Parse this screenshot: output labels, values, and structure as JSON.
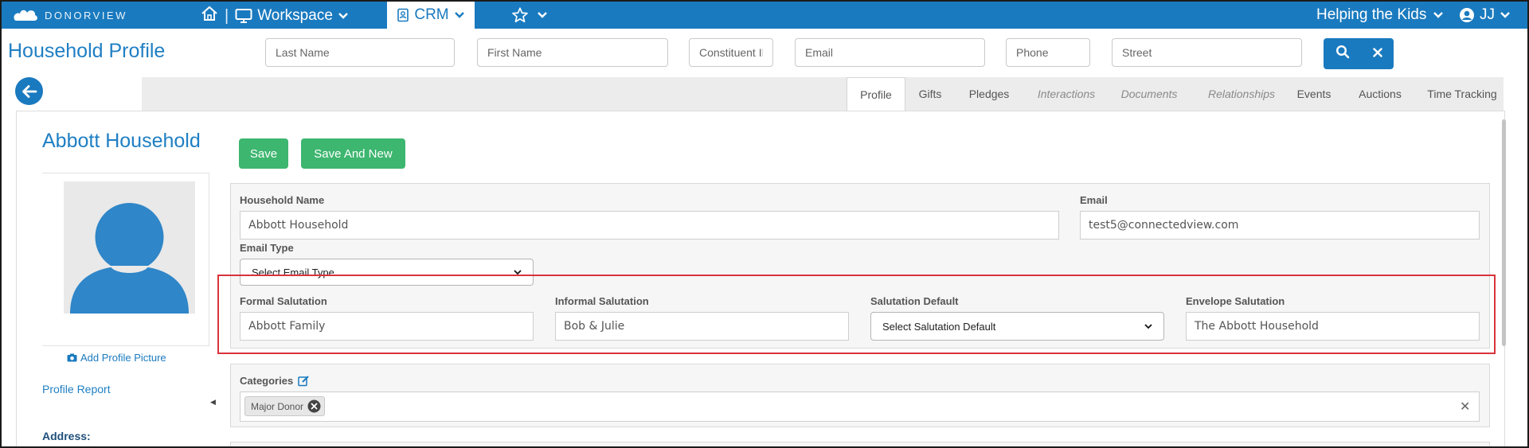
{
  "topbar": {
    "logo_text": "DONORVIEW",
    "workspace_label": "Workspace",
    "separator": "|",
    "crm_label": "CRM",
    "org_name": "Helping the Kids",
    "user_initials": "JJ"
  },
  "page_title": "Household Profile",
  "search": {
    "last_name_placeholder": "Last Name",
    "first_name_placeholder": "First Name",
    "constituent_placeholder": "Constituent ID",
    "email_placeholder": "Email",
    "phone_placeholder": "Phone",
    "street_placeholder": "Street"
  },
  "tabs": [
    {
      "label": "Profile"
    },
    {
      "label": "Gifts"
    },
    {
      "label": "Pledges"
    },
    {
      "label": "Interactions"
    },
    {
      "label": "Documents"
    },
    {
      "label": "Relationships"
    },
    {
      "label": "Events"
    },
    {
      "label": "Auctions"
    },
    {
      "label": "Time Tracking"
    }
  ],
  "sidebar": {
    "household_title": "Abbott Household",
    "add_picture_label": "Add Profile Picture",
    "profile_report_label": "Profile Report",
    "address_label": "Address:"
  },
  "actions": {
    "save_label": "Save",
    "save_and_new_label": "Save And New"
  },
  "form": {
    "household_name_label": "Household Name",
    "household_name_value": "Abbott Household",
    "email_label": "Email",
    "email_value": "test5@connectedview.com",
    "email_type_label": "Email Type",
    "email_type_value": "Select Email Type",
    "formal_salutation_label": "Formal Salutation",
    "formal_salutation_value": "Abbott Family",
    "informal_salutation_label": "Informal Salutation",
    "informal_salutation_value": "Bob & Julie",
    "salutation_default_label": "Salutation Default",
    "salutation_default_value": "Select Salutation Default",
    "envelope_salutation_label": "Envelope Salutation",
    "envelope_salutation_value": "The Abbott Household"
  },
  "categories": {
    "label": "Categories",
    "chips": [
      "Major Donor"
    ]
  },
  "colors": {
    "brand_blue": "#1a7abf",
    "save_green": "#3db66f",
    "highlight_red": "#d9343b"
  }
}
